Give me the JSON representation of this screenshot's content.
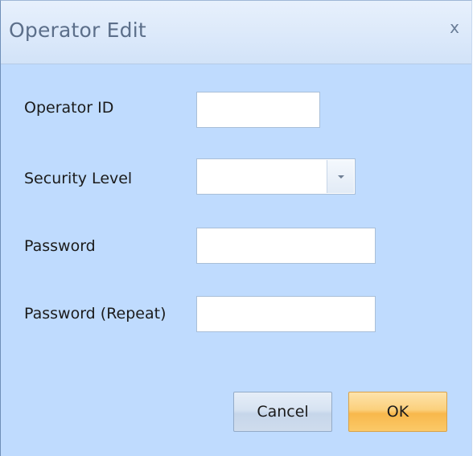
{
  "dialog": {
    "title": "Operator Edit",
    "close_glyph": "x"
  },
  "form": {
    "operator_id": {
      "label": "Operator ID",
      "value": ""
    },
    "security_level": {
      "label": "Security Level",
      "selected": ""
    },
    "password": {
      "label": "Password",
      "value": ""
    },
    "password_repeat": {
      "label": "Password (Repeat)",
      "value": ""
    }
  },
  "buttons": {
    "cancel_label": "Cancel",
    "ok_label": "OK"
  },
  "icons": {
    "close": "close-icon",
    "dropdown": "chevron-down-icon"
  },
  "colors": {
    "body_background": "#bfdbfe",
    "ok_button": "#f8b84c",
    "cancel_button": "#d7e3f2"
  }
}
